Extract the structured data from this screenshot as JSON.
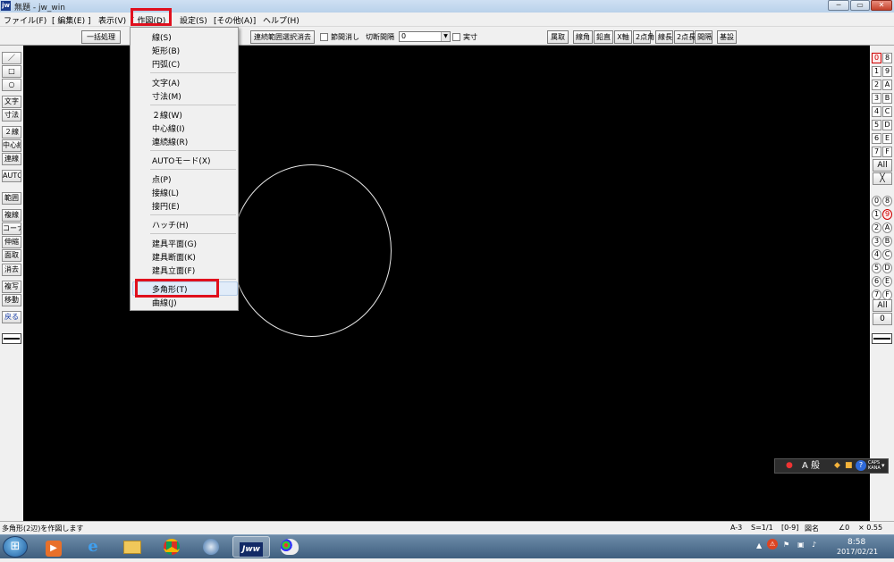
{
  "window": {
    "icon_text": "jw",
    "title": "無題 - jw_win",
    "controls": [
      "─",
      "▭",
      "✕"
    ]
  },
  "menubar": {
    "items": [
      "ファイル(F)",
      "[ 編集(E) ]",
      "表示(V)",
      "[ 作図(D) ]",
      "設定(S)",
      "[その他(A)]",
      "ヘルプ(H)"
    ]
  },
  "toolbar": {
    "batch_button": "一括処理",
    "continuous_clear_button": "連続範囲選択消去",
    "section_erase_label": "節間消し",
    "cut_interval_label": "切断間隔",
    "cut_interval_value": "0",
    "actual_size_label": "実寸",
    "right_buttons": [
      "属取",
      "線角",
      "鉛直",
      "X軸",
      "2点角",
      "線長",
      "2点長",
      "間隔",
      "基設"
    ]
  },
  "left_tools": [
    "／",
    "□",
    "○",
    "文字",
    "寸法",
    "２線",
    "中心線",
    "連線",
    "AUTO",
    "範囲",
    "複線",
    "コーナー",
    "伸縮",
    "面取",
    "消去",
    "複写",
    "移動",
    "戻る"
  ],
  "right_layers": {
    "layer_pairs": [
      [
        "0",
        "8"
      ],
      [
        "1",
        "9"
      ],
      [
        "2",
        "A"
      ],
      [
        "3",
        "B"
      ],
      [
        "4",
        "C"
      ],
      [
        "5",
        "D"
      ],
      [
        "6",
        "E"
      ],
      [
        "7",
        "F"
      ]
    ],
    "all_label": "All",
    "x_label": "╳",
    "group_pairs": [
      [
        "0",
        "8"
      ],
      [
        "1",
        "9"
      ],
      [
        "2",
        "A"
      ],
      [
        "3",
        "B"
      ],
      [
        "4",
        "C"
      ],
      [
        "5",
        "D"
      ],
      [
        "6",
        "E"
      ],
      [
        "7",
        "F"
      ]
    ],
    "group_all_label": "All",
    "group_zero_label": "0",
    "active_layer": "0",
    "active_group": "9"
  },
  "draw_menu": {
    "title": "作図(D)",
    "items": [
      "線(S)",
      "矩形(B)",
      "円弧(C)",
      "文字(A)",
      "寸法(M)",
      "２線(W)",
      "中心線(I)",
      "連続線(R)",
      "AUTOモード(X)",
      "点(P)",
      "接線(L)",
      "接円(E)",
      "ハッチ(H)",
      "建具平面(G)",
      "建具断面(K)",
      "建具立面(F)",
      "多角形(T)",
      "曲線(J)"
    ],
    "highlighted": "多角形(T)"
  },
  "ime_bar": {
    "mode": "A 般",
    "caps": "CAPS",
    "kana": "KANA"
  },
  "statusbar": {
    "message": "多角形(2辺)を作図します",
    "paper": "A-3",
    "scale": "S=1/1",
    "layer": "[0-9]",
    "layer_name": "図名",
    "angle": "∠0",
    "zoom": "× 0.55"
  },
  "taskbar": {
    "start_icon": "windows-orb",
    "apps": [
      "media-player",
      "internet-explorer",
      "file-explorer",
      "chrome",
      "thunderbird",
      "jw-cad",
      "paint"
    ],
    "jw_label": "Jww",
    "time": "8:58",
    "date": "2017/02/21"
  }
}
